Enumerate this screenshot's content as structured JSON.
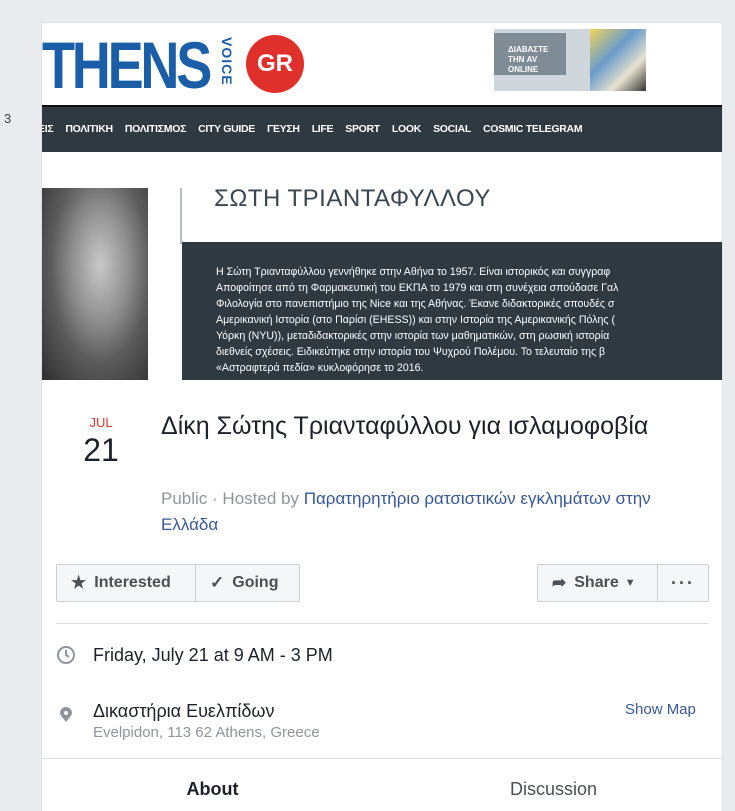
{
  "sidebar": {
    "count": "3"
  },
  "cover": {
    "logo_text": "THENS",
    "logo_voice": "VOICE",
    "logo_badge": "GR",
    "promo_label": "ΔΙΑΒΑΣΤΕ ΤΗΝ AV ONLINE",
    "nav_items": [
      "ΕΙΣ",
      "ΠΟΛΙΤΙΚΗ",
      "ΠΟΛΙΤΙΣΜΟΣ",
      "CITY GUIDE",
      "ΓΕΥΣΗ",
      "LIFE",
      "SPORT",
      "LOOK",
      "SOCIAL",
      "COSMIC TELEGRAM"
    ],
    "author_name": "ΣΩΤΗ ΤΡΙΑΝΤΑΦΥΛΛΟΥ",
    "bio": "Η Σώτη Τριανταφύλλου γεννήθηκε στην Αθήνα το 1957. Είναι ιστορικός και συγγραφ\nΑποφοίτησε από τη Φαρμακευτική του ΕΚΠΑ το 1979 και στη συνέχεια σπούδασε Γαλ\nΦιλολογία στο πανεπιστήμιο της Nice και της Αθήνας. Έκανε διδακτορικές σπουδές σ\nΑμερικανική Ιστορία (στο Παρίσι (EHESS)) και στην Ιστορία της Αμερικανικής Πόλης (\nΥόρκη (NYU)), μεταδιδακτορικές στην ιστορία των μαθηματικών, στη ρωσική ιστορία \nδιεθνείς σχέσεις. Ειδικεύτηκε στην ιστορία του Ψυχρού Πολέμου. Το τελευταίο της β\n«Αστραφτερά πεδία» κυκλοφόρησε το 2016."
  },
  "event": {
    "month": "JUL",
    "day": "21",
    "title": "Δίκη Σώτης Τριανταφύλλου για ισλαμοφοβία",
    "privacy": "Public",
    "hosted_by_prefix": " · Hosted by ",
    "host": "Παρατηρητήριο ρατσιστικών εγκλημάτων στην Ελλάδα"
  },
  "actions": {
    "interested": "Interested",
    "going": "Going",
    "share": "Share",
    "more": "···"
  },
  "details": {
    "time": "Friday, July 21 at 9 AM - 3 PM",
    "place_name": "Δικαστήρια Ευελπίδων",
    "place_address": "Evelpidon, 113 62 Athens, Greece",
    "show_map": "Show Map"
  },
  "tabs": [
    "About",
    "Discussion"
  ],
  "colors": {
    "accent": "#365899",
    "date_red": "#e0302c",
    "nav_bg": "#2f3942",
    "logo_blue": "#1b5ea8"
  }
}
